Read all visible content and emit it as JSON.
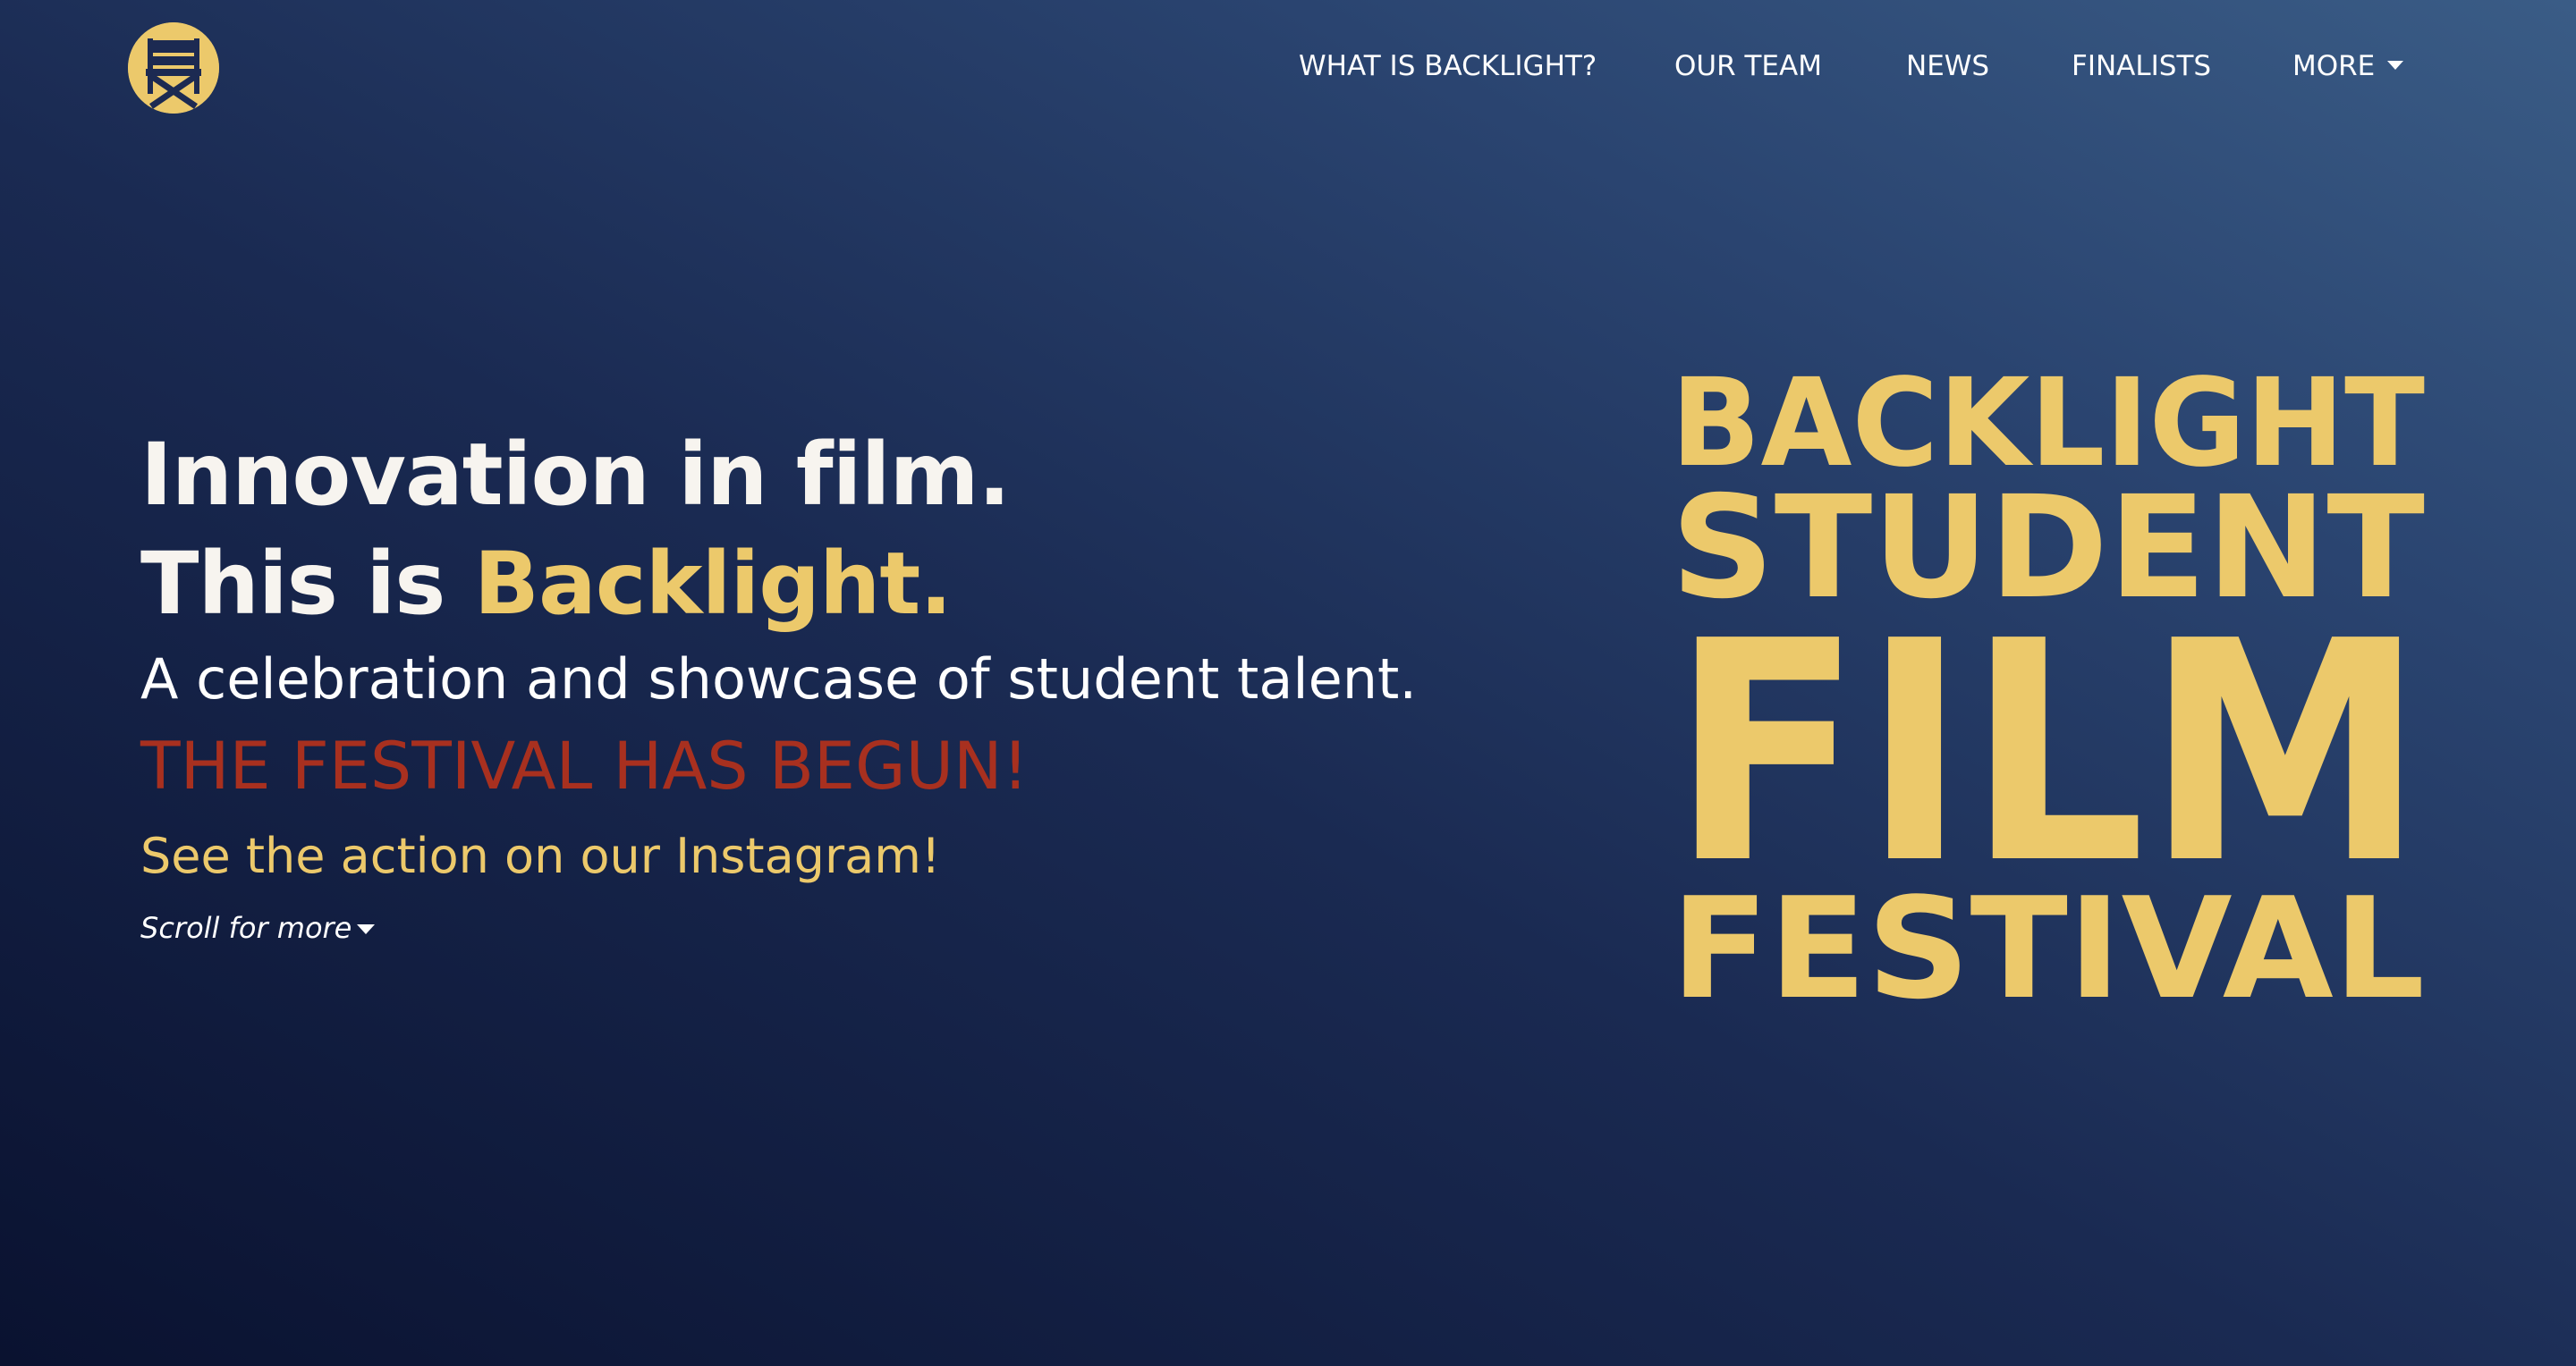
{
  "nav": {
    "logo_icon": "directors-chair-icon",
    "links": [
      {
        "label": "WHAT IS BACKLIGHT?"
      },
      {
        "label": "OUR TEAM"
      },
      {
        "label": "NEWS"
      },
      {
        "label": "FINALISTS"
      },
      {
        "label": "MORE",
        "icon": "caret-down-icon"
      }
    ]
  },
  "hero": {
    "headline_line1": "Innovation in film.",
    "headline_line2_prefix": "This is ",
    "headline_line2_accent": "Backlight.",
    "tagline": "A celebration and showcase of student talent.",
    "announcement": "THE FESTIVAL HAS BEGUN!",
    "instagram_link": "See the action on our Instagram!",
    "scroll_hint": "Scroll for more",
    "scroll_icon": "caret-down-icon"
  },
  "wordmark": {
    "line1": "BACKLIGHT",
    "line2": "STUDENT",
    "line3": "FILM",
    "line4": "FESTIVAL"
  },
  "colors": {
    "accent_gold": "#ecc96b",
    "announcement_red": "#a8301f",
    "background_dark": "#0a1230",
    "background_light": "#3a5c86",
    "text_white": "#ffffff"
  }
}
